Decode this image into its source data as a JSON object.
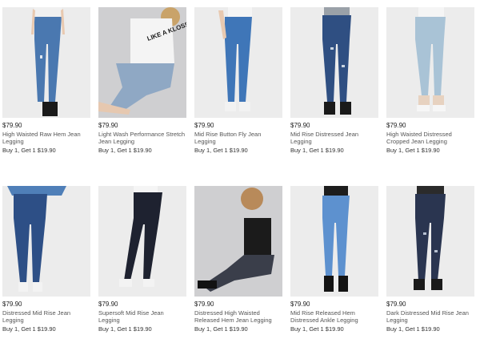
{
  "colors": {
    "photo_bg_light": "#ececec",
    "photo_bg_dark": "#cfcfd1",
    "denim_medium": "#4a78b0",
    "denim_light": "#a9c3d6",
    "denim_dark": "#2a3550",
    "black_denim": "#1e2230"
  },
  "products": [
    {
      "price": "$79.90",
      "name": "High Waisted Raw Hem Jean Legging",
      "promo": "Buy 1, Get 1 $19.90"
    },
    {
      "price": "$79.90",
      "name": "Light Wash Performance Stretch Jean Legging",
      "promo": "Buy 1, Get 1 $19.90",
      "shirt_text": "LIKE A KLOSS"
    },
    {
      "price": "$79.90",
      "name": "Mid Rise Button Fly Jean Legging",
      "promo": "Buy 1, Get 1 $19.90"
    },
    {
      "price": "$79.90",
      "name": "Mid Rise Distressed Jean Legging",
      "promo": "Buy 1, Get 1 $19.90"
    },
    {
      "price": "$79.90",
      "name": "High Waisted Distressed Cropped Jean Legging",
      "promo": "Buy 1, Get 1 $19.90"
    },
    {
      "price": "$79.90",
      "name": "Distressed Mid Rise Jean Legging",
      "promo": "Buy 1, Get 1 $19.90"
    },
    {
      "price": "$79.90",
      "name": "Supersoft Mid Rise Jean Legging",
      "promo": "Buy 1, Get 1 $19.90"
    },
    {
      "price": "$79.90",
      "name": "Distressed High Waisted Released Hem Jean Legging",
      "promo": "Buy 1, Get 1 $19.90"
    },
    {
      "price": "$79.90",
      "name": "Mid Rise Released Hem Distressed Ankle Legging",
      "promo": "Buy 1, Get 1 $19.90"
    },
    {
      "price": "$79.90",
      "name": "Dark Distressed Mid Rise Jean Legging",
      "promo": "Buy 1, Get 1 $19.90"
    }
  ]
}
